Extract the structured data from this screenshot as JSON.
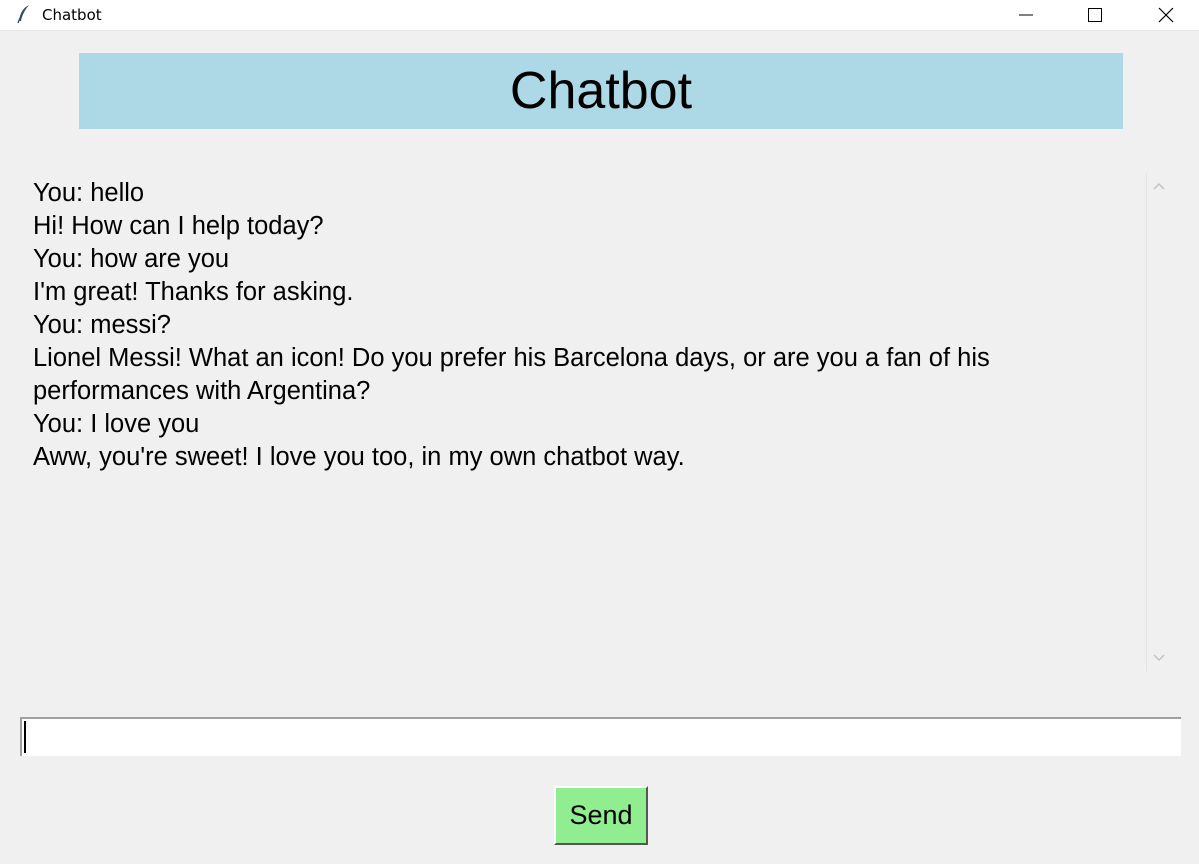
{
  "window": {
    "title": "Chatbot"
  },
  "header": {
    "title": "Chatbot",
    "background": "#add8e6"
  },
  "chat": {
    "messages": [
      "You: hello",
      "Hi! How can I help today?",
      "You: how are you",
      "I'm great! Thanks for asking.",
      "You: messi?",
      "Lionel Messi! What an icon! Do you prefer his Barcelona days, or are you a fan of his performances with Argentina?",
      "You: I love you",
      "Aww, you're sweet! I love you too, in my own chatbot way."
    ]
  },
  "input": {
    "value": ""
  },
  "send_button": {
    "label": "Send",
    "background": "#90ee90"
  },
  "icons": {
    "app": "feather-icon",
    "minimize": "minimize-icon",
    "maximize": "maximize-icon",
    "close": "close-icon",
    "scroll_up": "chevron-up-icon",
    "scroll_down": "chevron-down-icon"
  }
}
